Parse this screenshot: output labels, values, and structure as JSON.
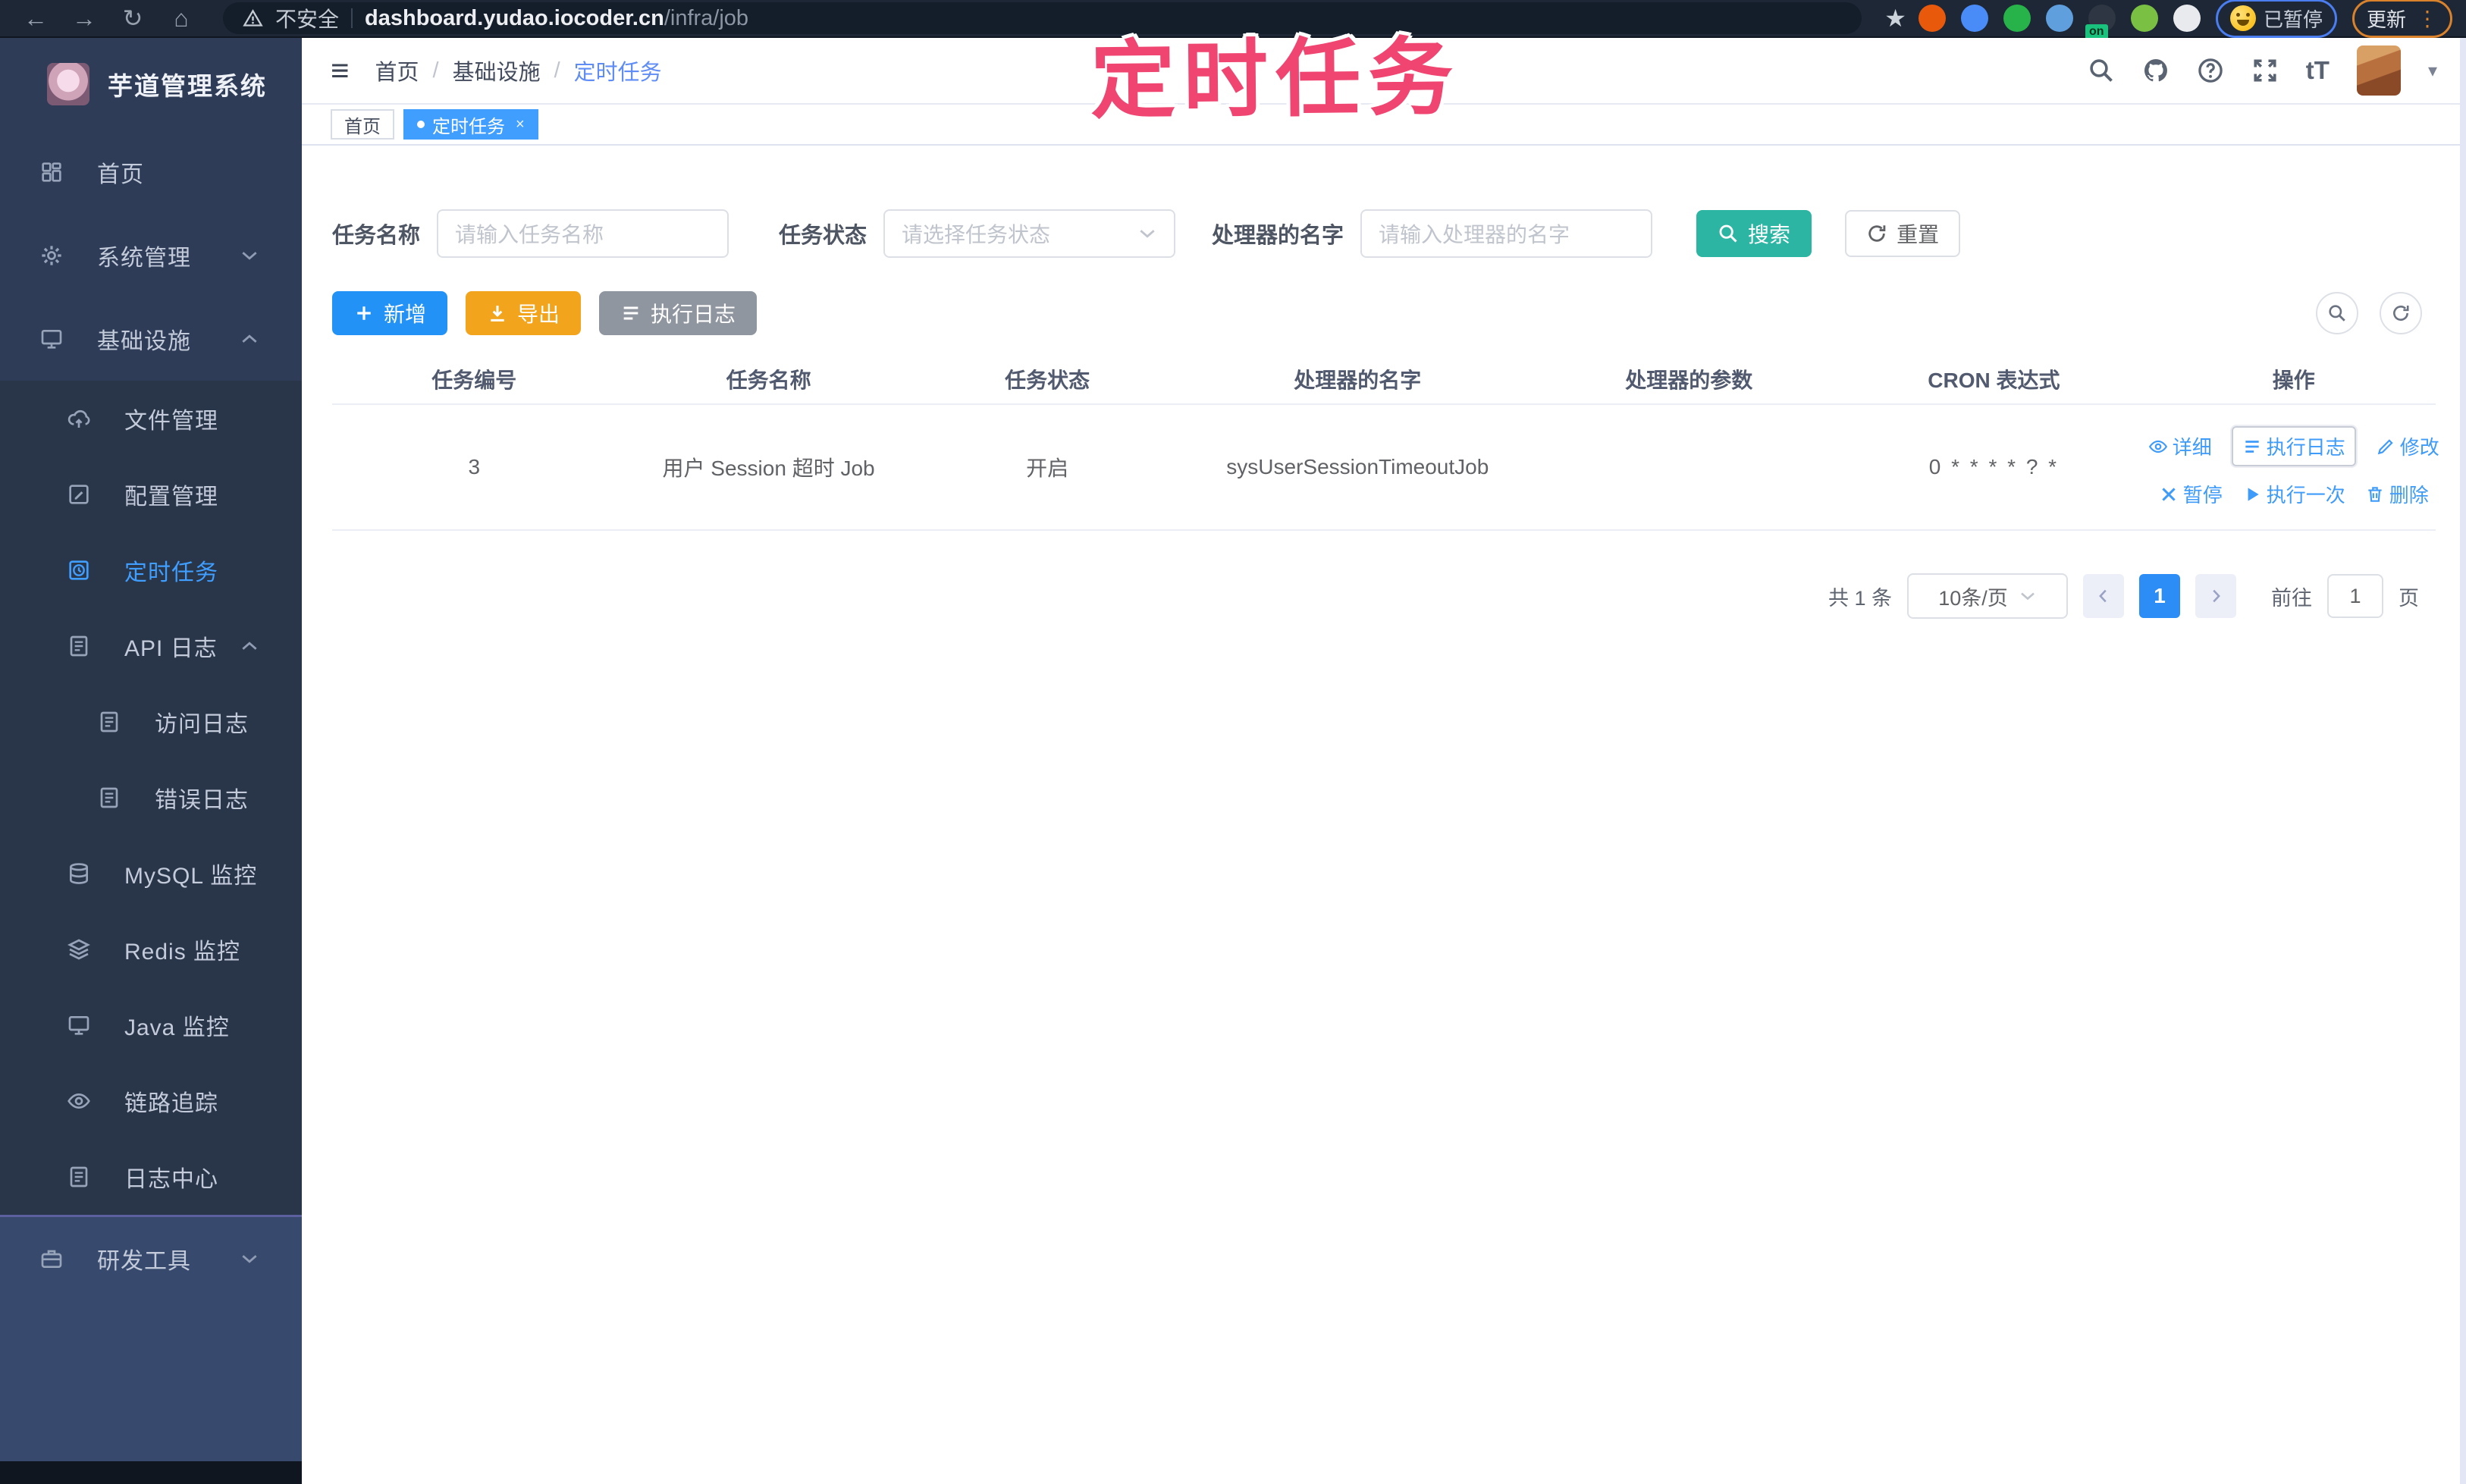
{
  "browser": {
    "security_label": "不安全",
    "url_domain": "dashboard.yudao.iocoder.cn",
    "url_path": "/infra/job",
    "paused_label": "已暂停",
    "update_label": "更新",
    "extensions": [
      {
        "name": "ext-orange-ring",
        "color": "#e8590c"
      },
      {
        "name": "ext-blue-drop",
        "color": "#4a8cf7"
      },
      {
        "name": "ext-green-check",
        "color": "#27b24a"
      },
      {
        "name": "ext-blue-cube",
        "color": "#5f9fdd"
      },
      {
        "name": "ext-dark-switch",
        "color": "#2d3642",
        "badge": "on"
      },
      {
        "name": "ext-green-leaf",
        "color": "#7ac143"
      },
      {
        "name": "ext-puzzle",
        "color": "#e8eaed"
      }
    ]
  },
  "annotation": {
    "text": "定时任务",
    "color": "#ef4570"
  },
  "sidebar": {
    "logo_title": "芋道管理系统",
    "items": [
      {
        "label": "首页",
        "icon": "grid-icon",
        "level": 0
      },
      {
        "label": "系统管理",
        "icon": "gear-icon",
        "level": 0,
        "chevron": "down"
      },
      {
        "label": "基础设施",
        "icon": "monitor-icon",
        "level": 0,
        "chevron": "up"
      },
      {
        "label": "文件管理",
        "icon": "cloud-icon",
        "level": 1
      },
      {
        "label": "配置管理",
        "icon": "edit-icon",
        "level": 1
      },
      {
        "label": "定时任务",
        "icon": "clock-icon",
        "level": 1,
        "active": true
      },
      {
        "label": "API 日志",
        "icon": "doc-icon",
        "level": 1,
        "chevron": "up"
      },
      {
        "label": "访问日志",
        "icon": "doc-icon",
        "level": 2
      },
      {
        "label": "错误日志",
        "icon": "doc-icon",
        "level": 2
      },
      {
        "label": "MySQL 监控",
        "icon": "database-icon",
        "level": 1
      },
      {
        "label": "Redis 监控",
        "icon": "stack-icon",
        "level": 1
      },
      {
        "label": "Java 监控",
        "icon": "monitor-icon",
        "level": 1
      },
      {
        "label": "链路追踪",
        "icon": "eye-icon",
        "level": 1
      },
      {
        "label": "日志中心",
        "icon": "doc-icon",
        "level": 1
      },
      {
        "label": "研发工具",
        "icon": "briefcase-icon",
        "level": 0,
        "chevron": "down",
        "section": "bottom"
      }
    ]
  },
  "header": {
    "breadcrumb": [
      "首页",
      "基础设施",
      "定时任务"
    ]
  },
  "tags": [
    {
      "label": "首页",
      "active": false,
      "closable": false
    },
    {
      "label": "定时任务",
      "active": true,
      "closable": true
    }
  ],
  "filters": {
    "name_label": "任务名称",
    "name_placeholder": "请输入任务名称",
    "status_label": "任务状态",
    "status_placeholder": "请选择任务状态",
    "handler_label": "处理器的名字",
    "handler_placeholder": "请输入处理器的名字",
    "search_label": "搜索",
    "reset_label": "重置"
  },
  "toolbar": {
    "add_label": "新增",
    "export_label": "导出",
    "joblog_label": "执行日志"
  },
  "table": {
    "columns": [
      "任务编号",
      "任务名称",
      "任务状态",
      "处理器的名字",
      "处理器的参数",
      "CRON 表达式",
      "操作"
    ],
    "rows": [
      {
        "id": "3",
        "name": "用户 Session 超时 Job",
        "status": "开启",
        "handler": "sysUserSessionTimeoutJob",
        "param": "",
        "cron": "0 * * * * ? *",
        "actions_row1": [
          {
            "label": "详细",
            "icon": "eye-icon"
          },
          {
            "label": "执行日志",
            "icon": "list-icon",
            "boxed": true
          },
          {
            "label": "修改",
            "icon": "pencil-icon"
          }
        ],
        "actions_row2": [
          {
            "label": "暂停",
            "icon": "x-icon"
          },
          {
            "label": "执行一次",
            "icon": "play-icon"
          },
          {
            "label": "删除",
            "icon": "trash-icon"
          }
        ]
      }
    ]
  },
  "pagination": {
    "total_label": "共 1 条",
    "page_size": "10条/页",
    "current_page": "1",
    "goto_label": "前往",
    "goto_value": "1",
    "page_unit": "页"
  },
  "colors": {
    "accent_blue": "#409eff",
    "search_teal": "#2db5a3",
    "export_orange": "#f2a41c",
    "gray_button": "#90969f",
    "annotation_pink": "#ef4570",
    "sidebar_bg": "#2e3c57"
  }
}
